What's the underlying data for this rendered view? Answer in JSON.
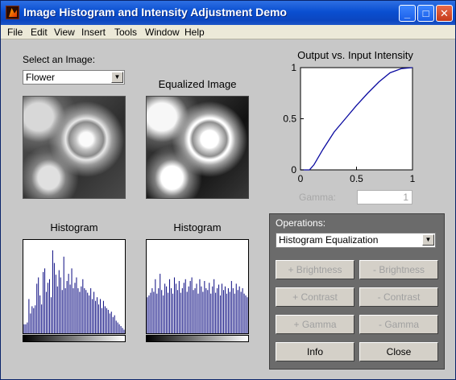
{
  "window": {
    "title": "Image Histogram and Intensity Adjustment Demo"
  },
  "menu": [
    "File",
    "Edit",
    "View",
    "Insert",
    "Tools",
    "Window",
    "Help"
  ],
  "select_image": {
    "label": "Select an Image:",
    "value": "Flower"
  },
  "equalized_label": "Equalized Image",
  "histogram_label_left": "Histogram",
  "histogram_label_right": "Histogram",
  "chart": {
    "title": "Output vs. Input Intensity",
    "x_ticks": [
      "0",
      "0.5",
      "1"
    ],
    "y_ticks": [
      "0",
      "0.5",
      "1"
    ]
  },
  "chart_data": {
    "type": "line",
    "title": "Output vs. Input Intensity",
    "xlabel": "",
    "ylabel": "",
    "xlim": [
      0,
      1
    ],
    "ylim": [
      0,
      1
    ],
    "series": [
      {
        "x": [
          0,
          0.08,
          0.12,
          0.2,
          0.3,
          0.4,
          0.5,
          0.6,
          0.7,
          0.8,
          0.9,
          1.0
        ],
        "y": [
          0,
          0,
          0.05,
          0.2,
          0.37,
          0.5,
          0.63,
          0.75,
          0.86,
          0.95,
          0.99,
          1.0
        ]
      }
    ],
    "color": "#0a0aa0"
  },
  "gamma": {
    "label": "Gamma:",
    "value": "1"
  },
  "operations": {
    "label": "Operations:",
    "selected": "Histogram Equalization",
    "buttons": {
      "plus_brightness": "+ Brightness",
      "minus_brightness": "- Brightness",
      "plus_contrast": "+ Contrast",
      "minus_contrast": "- Contrast",
      "plus_gamma": "+ Gamma",
      "minus_gamma": "- Gamma",
      "info": "Info",
      "close": "Close"
    }
  },
  "hist_left": [
    0.1,
    0.1,
    0.12,
    0.38,
    0.22,
    0.3,
    0.28,
    0.31,
    0.55,
    0.62,
    0.42,
    0.32,
    0.68,
    0.72,
    0.46,
    0.56,
    0.6,
    0.4,
    0.92,
    0.78,
    0.65,
    0.52,
    0.7,
    0.62,
    0.48,
    0.85,
    0.5,
    0.58,
    0.66,
    0.54,
    0.72,
    0.5,
    0.56,
    0.62,
    0.5,
    0.46,
    0.52,
    0.6,
    0.5,
    0.48,
    0.45,
    0.42,
    0.5,
    0.38,
    0.46,
    0.36,
    0.4,
    0.32,
    0.38,
    0.28,
    0.36,
    0.3,
    0.28,
    0.26,
    0.22,
    0.24,
    0.18,
    0.2,
    0.14,
    0.12,
    0.1,
    0.08,
    0.06,
    0.04
  ],
  "hist_right": [
    0.4,
    0.42,
    0.45,
    0.5,
    0.46,
    0.6,
    0.44,
    0.5,
    0.66,
    0.48,
    0.42,
    0.55,
    0.52,
    0.45,
    0.6,
    0.5,
    0.44,
    0.62,
    0.55,
    0.48,
    0.58,
    0.45,
    0.5,
    0.56,
    0.6,
    0.46,
    0.52,
    0.58,
    0.62,
    0.48,
    0.5,
    0.55,
    0.44,
    0.6,
    0.52,
    0.46,
    0.58,
    0.5,
    0.48,
    0.56,
    0.44,
    0.52,
    0.6,
    0.45,
    0.5,
    0.54,
    0.42,
    0.55,
    0.48,
    0.52,
    0.44,
    0.5,
    0.46,
    0.58,
    0.5,
    0.44,
    0.55,
    0.48,
    0.52,
    0.46,
    0.5,
    0.44,
    0.42,
    0.4
  ]
}
